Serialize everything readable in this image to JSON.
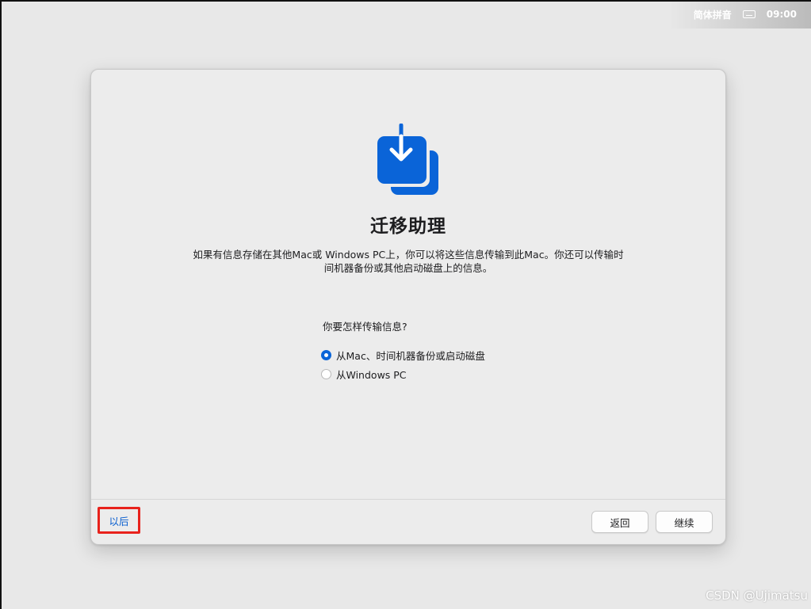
{
  "menubar": {
    "input_method": "简体拼音",
    "keyboard_icon": "keyboard-icon",
    "clock": "09:00"
  },
  "dialog": {
    "icon": "migration-download-icon",
    "accent_color": "#0a64d8",
    "title": "迁移助理",
    "description_line1": "如果有信息存储在其他Mac或 Windows PC上，你可以将这些信息传输到此Mac。你还可以传输时",
    "description_line2": "间机器备份或其他启动磁盘上的信息。",
    "question": "你要怎样传输信息?",
    "options": [
      {
        "label": "从Mac、时间机器备份或启动磁盘",
        "selected": true
      },
      {
        "label": "从Windows PC",
        "selected": false
      }
    ]
  },
  "footer": {
    "later_label": "以后",
    "back_label": "返回",
    "continue_label": "继续"
  },
  "watermark": "CSDN @Ujimatsu"
}
